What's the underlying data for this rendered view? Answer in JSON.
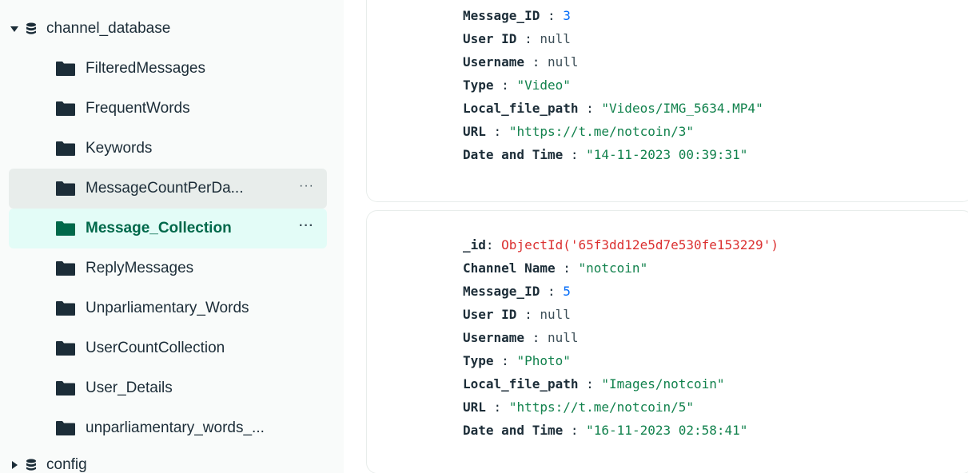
{
  "sidebar": {
    "database": {
      "name": "channel_database",
      "expanded": true,
      "caret": "caret-down",
      "icon": "database-icon"
    },
    "collections": [
      {
        "name": "FilteredMessages",
        "state": "normal"
      },
      {
        "name": "FrequentWords",
        "state": "normal"
      },
      {
        "name": "Keywords",
        "state": "normal"
      },
      {
        "name": "MessageCountPerDa...",
        "state": "hover",
        "more": "···"
      },
      {
        "name": "Message_Collection",
        "state": "active",
        "more": "···"
      },
      {
        "name": "ReplyMessages",
        "state": "normal"
      },
      {
        "name": "Unparliamentary_Words",
        "state": "normal"
      },
      {
        "name": "UserCountCollection",
        "state": "normal"
      },
      {
        "name": "User_Details",
        "state": "normal"
      },
      {
        "name": "unparliamentary_words_...",
        "state": "normal"
      }
    ],
    "next_database": {
      "name": "config",
      "expanded": false,
      "caret": "caret-right",
      "icon": "database-icon"
    }
  },
  "documents": [
    {
      "fields": [
        {
          "key": "Message_ID",
          "sep": " : ",
          "value": "3",
          "type": "number"
        },
        {
          "key": "User ID",
          "sep": " : ",
          "value": "null",
          "type": "null"
        },
        {
          "key": "Username",
          "sep": " : ",
          "value": "null",
          "type": "null"
        },
        {
          "key": "Type",
          "sep": " : ",
          "value": "\"Video\"",
          "type": "string"
        },
        {
          "key": "Local_file_path",
          "sep": " : ",
          "value": "\"Videos/IMG_5634.MP4\"",
          "type": "string"
        },
        {
          "key": "URL",
          "sep": " : ",
          "value": "\"https://t.me/notcoin/3\"",
          "type": "string"
        },
        {
          "key": "Date and Time",
          "sep": " : ",
          "value": "\"14-11-2023 00:39:31\"",
          "type": "string"
        }
      ]
    },
    {
      "fields": [
        {
          "key": "_id",
          "sep": ": ",
          "value": "ObjectId('65f3dd12e5d7e530fe153229')",
          "type": "objectid"
        },
        {
          "key": "Channel Name",
          "sep": " : ",
          "value": "\"notcoin\"",
          "type": "string"
        },
        {
          "key": "Message_ID",
          "sep": " : ",
          "value": "5",
          "type": "number"
        },
        {
          "key": "User ID",
          "sep": " : ",
          "value": "null",
          "type": "null"
        },
        {
          "key": "Username",
          "sep": " : ",
          "value": "null",
          "type": "null"
        },
        {
          "key": "Type",
          "sep": " : ",
          "value": "\"Photo\"",
          "type": "string"
        },
        {
          "key": "Local_file_path",
          "sep": " : ",
          "value": "\"Images/notcoin\"",
          "type": "string"
        },
        {
          "key": "URL",
          "sep": " : ",
          "value": "\"https://t.me/notcoin/5\"",
          "type": "string"
        },
        {
          "key": "Date and Time",
          "sep": " : ",
          "value": "\"16-11-2023 02:58:41\"",
          "type": "string"
        }
      ]
    }
  ],
  "colors": {
    "active_bg": "#e3fcf7",
    "active_text": "#00684a",
    "hover_bg": "#e8edeb",
    "string": "#12824d",
    "number": "#016bf8",
    "objectid": "#db3030"
  }
}
